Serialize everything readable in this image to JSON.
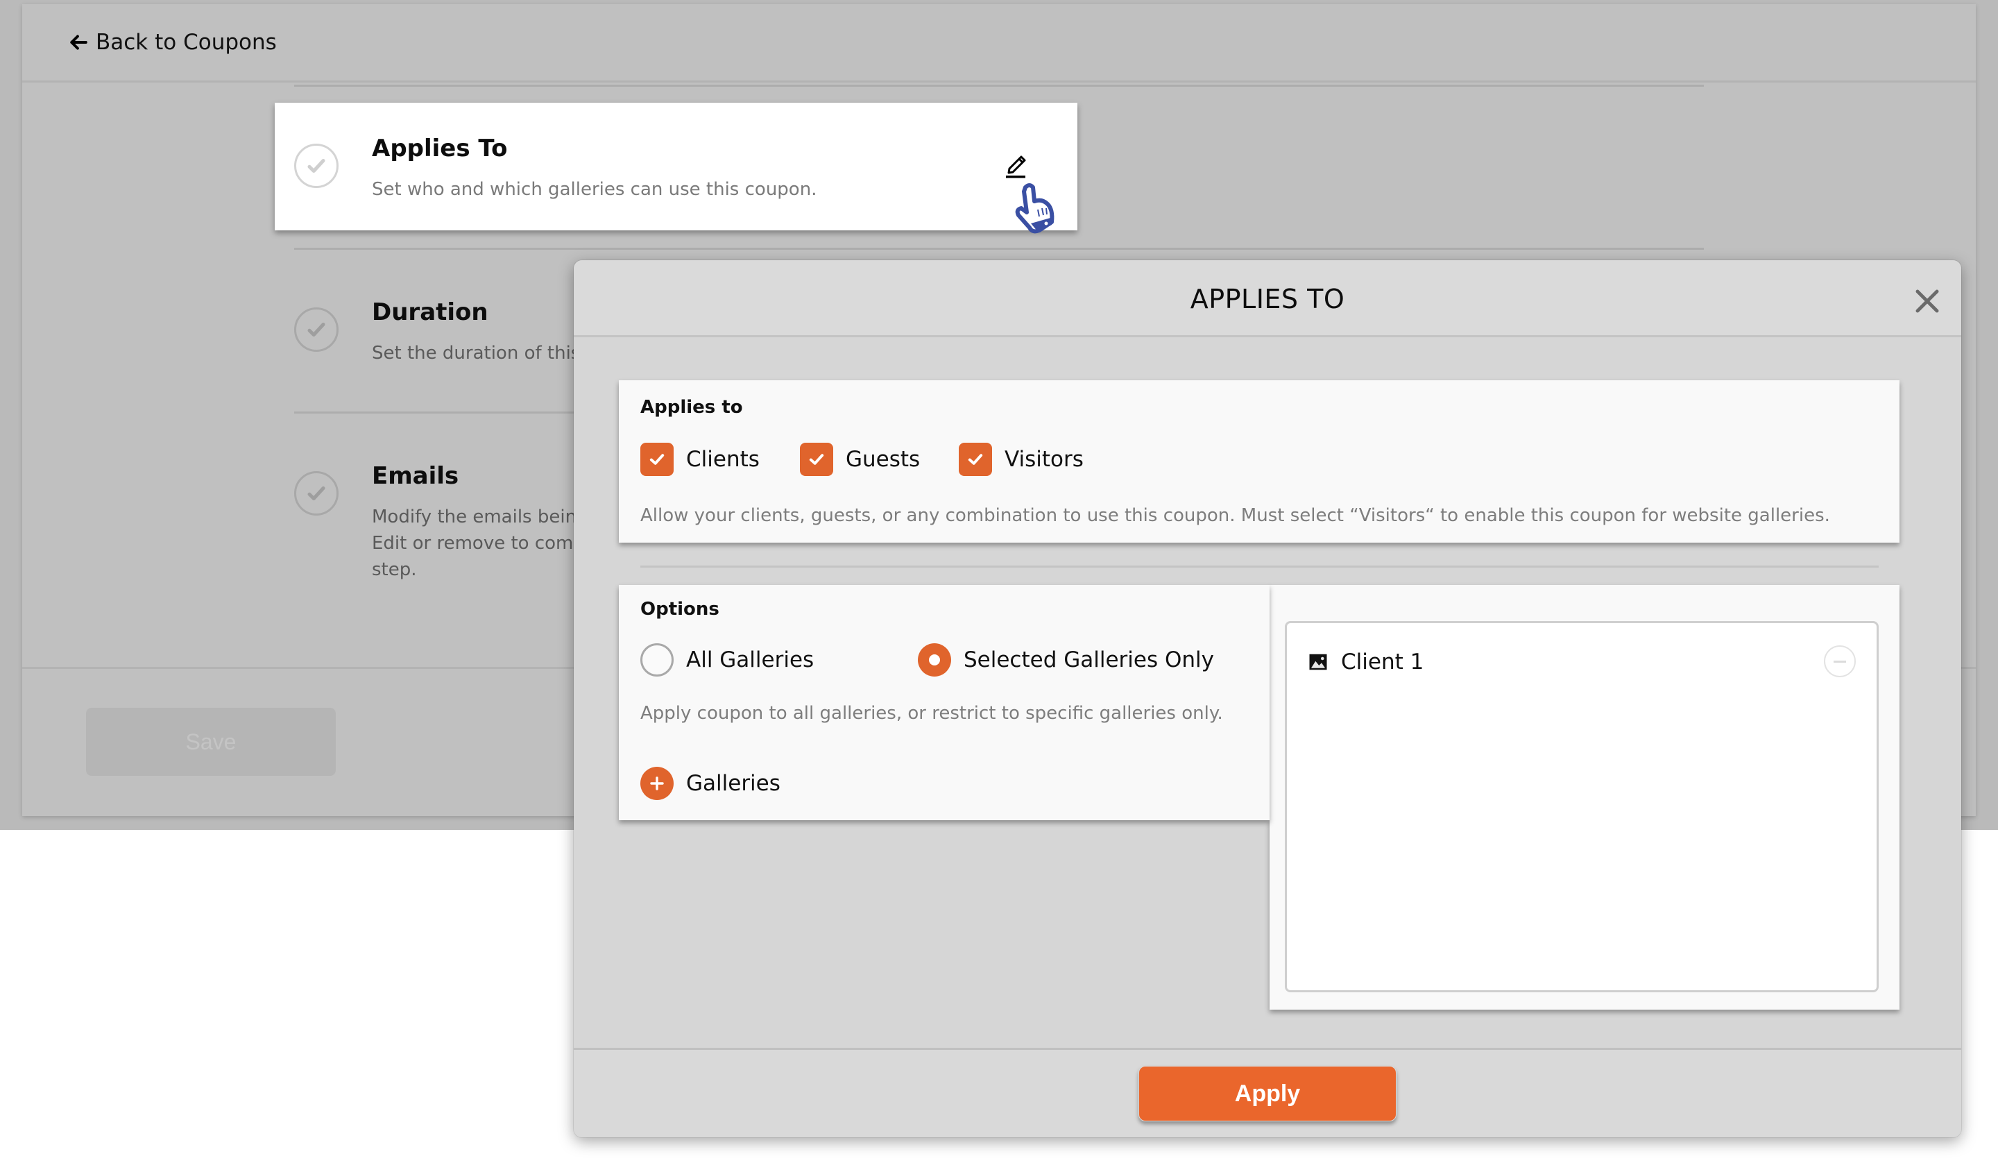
{
  "page": {
    "back_link": "Back to Coupons",
    "save_label": "Save",
    "steps": [
      {
        "title": "Applies To",
        "subtitle": "Set who and which galleries can use this coupon.",
        "active": true
      },
      {
        "title": "Duration",
        "subtitle": "Set the duration of this"
      },
      {
        "title": "Emails",
        "subtitle_lines": [
          "Modify the emails being",
          "Edit or remove to comp",
          "step."
        ]
      }
    ]
  },
  "modal": {
    "title": "APPLIES TO",
    "applies_to": {
      "label": "Applies to",
      "options": [
        {
          "label": "Clients",
          "checked": true
        },
        {
          "label": "Guests",
          "checked": true
        },
        {
          "label": "Visitors",
          "checked": true
        }
      ],
      "helper": "Allow your clients, guests, or any combination to use this coupon. Must select “Visitors“ to enable this coupon for website galleries."
    },
    "options": {
      "label": "Options",
      "radios": [
        {
          "label": "All Galleries",
          "selected": false
        },
        {
          "label": "Selected Galleries Only",
          "selected": true
        }
      ],
      "helper": "Apply coupon to all galleries, or restrict to specific galleries only.",
      "add_label": "Galleries"
    },
    "selected_galleries": [
      {
        "name": "Client 1",
        "icon": "image-icon"
      }
    ],
    "apply_label": "Apply"
  },
  "colors": {
    "accent": "#EA662C",
    "overlay": "#BABABA",
    "modal_bg": "#D6D6D6"
  }
}
